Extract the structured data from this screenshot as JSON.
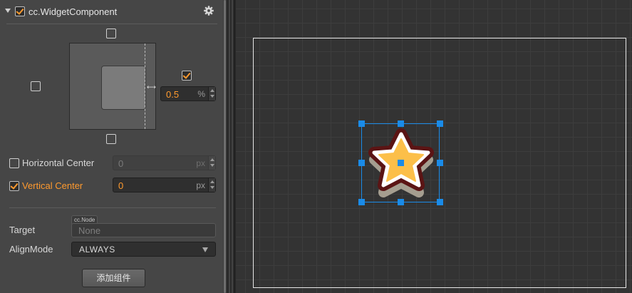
{
  "component": {
    "title": "cc.WidgetComponent",
    "enabled": true,
    "icons": {
      "collapse": "triangle-down-icon",
      "settings": "gear-icon"
    }
  },
  "align": {
    "top": false,
    "left": false,
    "right": true,
    "bottom": false,
    "right_value": "0.5",
    "right_unit": "%"
  },
  "horizontal_center": {
    "label": "Horizontal Center",
    "checked": false,
    "value": "0",
    "unit": "px"
  },
  "vertical_center": {
    "label": "Vertical Center",
    "checked": true,
    "value": "0",
    "unit": "px"
  },
  "target": {
    "label": "Target",
    "tag": "cc.Node",
    "placeholder": "None"
  },
  "align_mode": {
    "label": "AlignMode",
    "value": "ALWAYS"
  },
  "add_component_label": "添加组件",
  "colors": {
    "accent": "#ff9a2e",
    "selection": "#1a8be8",
    "panel": "#464646",
    "scene_bg": "#333333"
  }
}
